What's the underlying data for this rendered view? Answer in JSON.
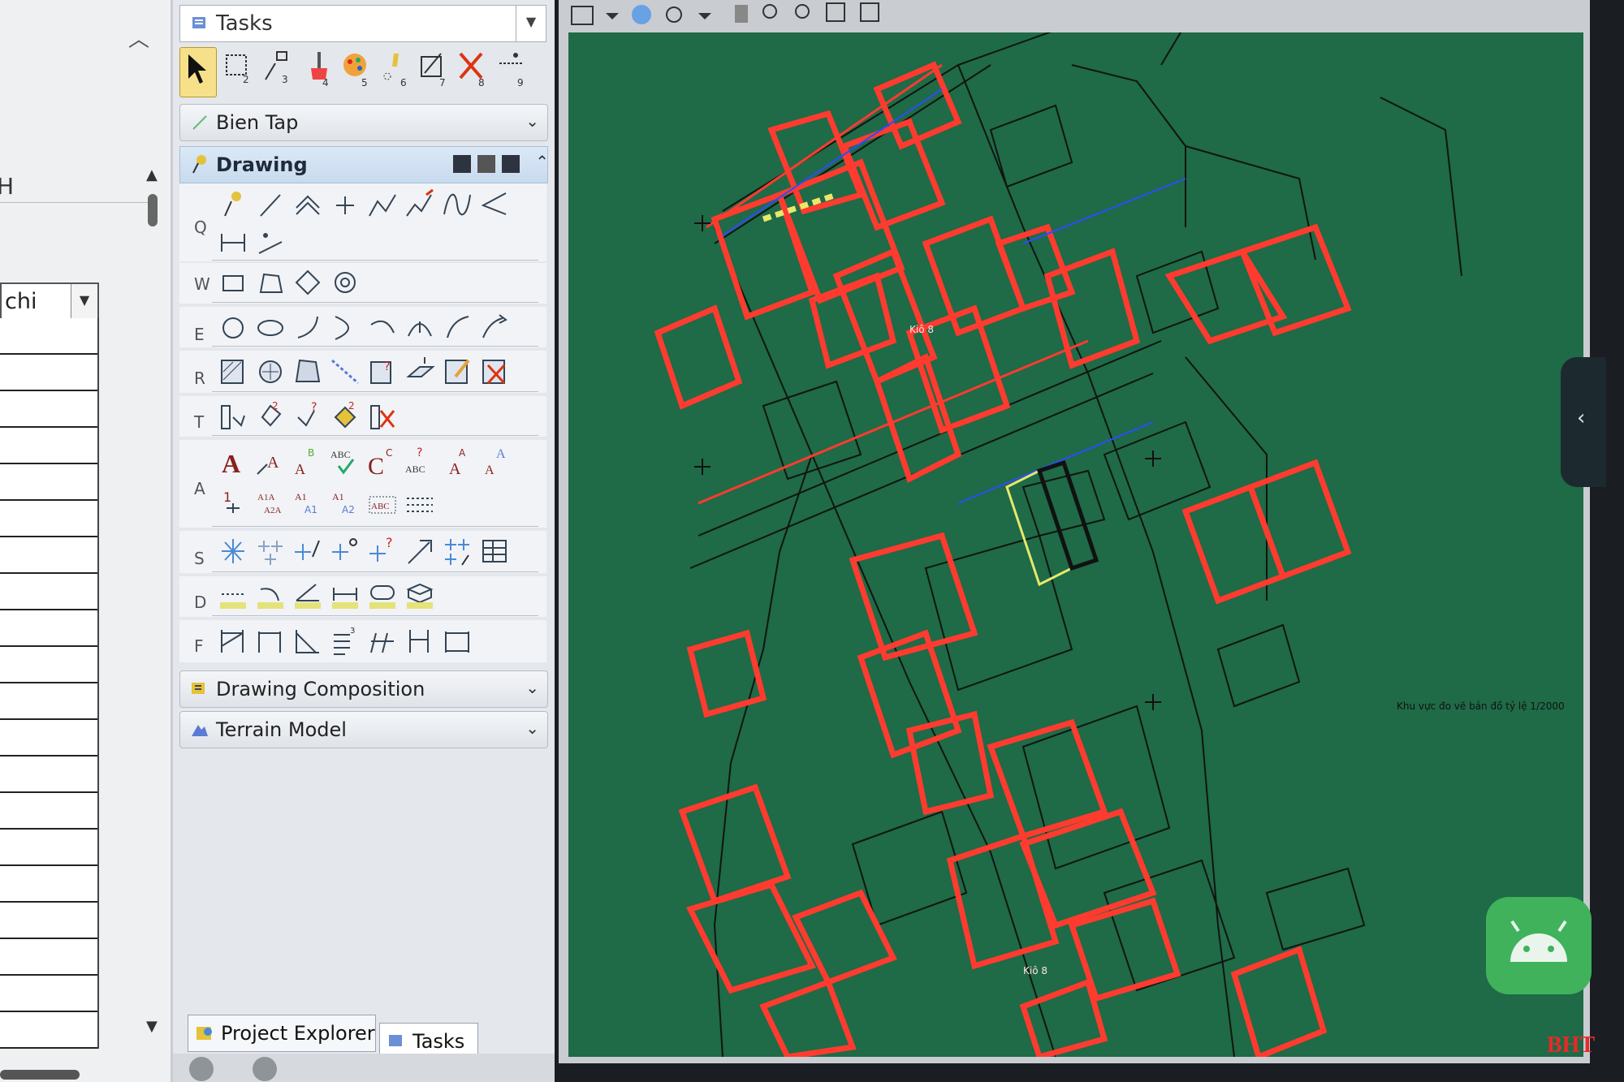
{
  "sheet": {
    "column_header": "H",
    "combo_value": "chi"
  },
  "tasks_panel": {
    "title": "Tasks",
    "sections": {
      "bien_tap": "Bien Tap",
      "drawing": "Drawing",
      "drawing_composition": "Drawing Composition",
      "terrain_model": "Terrain Model"
    },
    "group_keys": [
      "Q",
      "W",
      "E",
      "R",
      "T",
      "A",
      "S",
      "D",
      "F"
    ],
    "bottom_tabs": {
      "project_explorer": "Project Explorer",
      "tasks": "Tasks"
    }
  },
  "map": {
    "block_labels": [
      "Kiô 8",
      "Kiô 8"
    ],
    "note": "Khu vực đo vẽ bản đồ tỷ lệ 1/2000"
  },
  "watermark": "BHT",
  "colors": {
    "map_background": "#1f6a47",
    "parcel_highlight": "#ff3b2f",
    "parcel_outline": "#111111",
    "accent_blue": "#2c4cff",
    "selection_yellow": "#e8e86a"
  }
}
